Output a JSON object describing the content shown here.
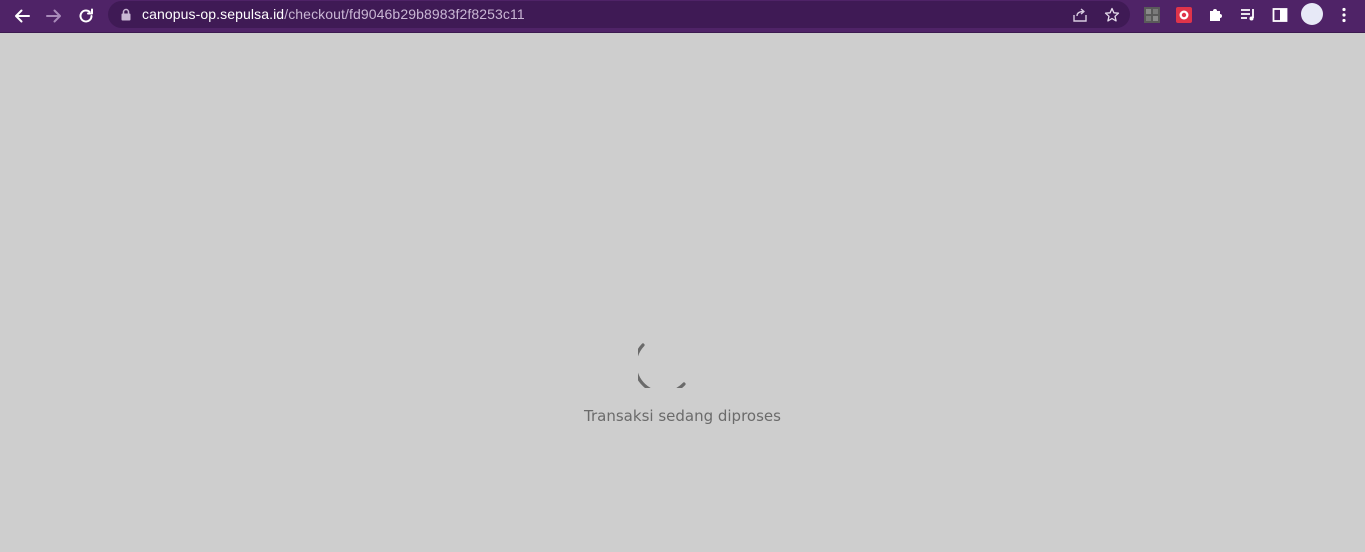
{
  "browser": {
    "url_host": "canopus-op.sepulsa.id",
    "url_path": "/checkout/fd9046b29b8983f2f8253c11",
    "icons": {
      "back": "arrow-left-icon",
      "forward": "arrow-right-icon",
      "reload": "reload-icon",
      "lock": "lock-icon",
      "share": "share-icon",
      "bookmark": "star-icon",
      "extension_1": "grid-extension-icon",
      "extension_2": "red-extension-icon",
      "extensions": "puzzle-icon",
      "media": "media-queue-icon",
      "side_panel": "side-panel-icon",
      "profile": "avatar-icon",
      "menu": "kebab-menu-icon"
    },
    "colors": {
      "toolbar": "#4f2367",
      "omnibox": "#3f1a55"
    }
  },
  "page": {
    "status_text": "Transaksi sedang diproses",
    "background": "#cecece"
  }
}
